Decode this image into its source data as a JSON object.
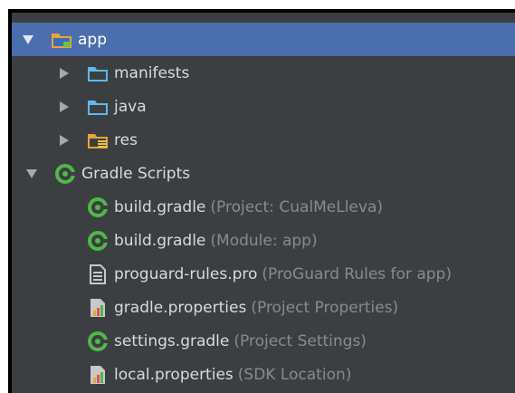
{
  "tree": {
    "items": [
      {
        "name": "app",
        "hint": "",
        "icon": "app-module-folder-icon",
        "expanded": true,
        "selected": true
      },
      {
        "name": "manifests",
        "hint": "",
        "icon": "folder-icon",
        "expanded": false
      },
      {
        "name": "java",
        "hint": "",
        "icon": "folder-icon",
        "expanded": false
      },
      {
        "name": "res",
        "hint": "",
        "icon": "resources-folder-icon",
        "expanded": false
      },
      {
        "name": "Gradle Scripts",
        "hint": "",
        "icon": "gradle-icon",
        "expanded": true
      },
      {
        "name": "build.gradle",
        "hint": "(Project: CualMeLleva)",
        "icon": "gradle-icon"
      },
      {
        "name": "build.gradle",
        "hint": "(Module: app)",
        "icon": "gradle-icon"
      },
      {
        "name": "proguard-rules.pro",
        "hint": "(ProGuard Rules for app)",
        "icon": "text-file-icon"
      },
      {
        "name": "gradle.properties",
        "hint": "(Project Properties)",
        "icon": "properties-file-icon"
      },
      {
        "name": "settings.gradle",
        "hint": "(Project Settings)",
        "icon": "gradle-icon"
      },
      {
        "name": "local.properties",
        "hint": "(SDK Location)",
        "icon": "properties-file-icon"
      }
    ]
  },
  "colors": {
    "panel_background": "#3c3f41",
    "selection": "#4b6eaf",
    "text": "#dadada",
    "hint_text": "#8a8a8a",
    "folder_blue": "#5fb8e8",
    "folder_orange": "#e8a33d",
    "gradle_green": "#50b848"
  }
}
